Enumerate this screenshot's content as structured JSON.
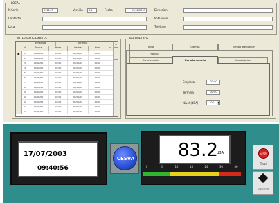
{
  "header": {
    "group_title": "LOCAL",
    "n_serie_label": "N.Serie",
    "n_serie_value": "012147",
    "version_label": "Versión",
    "version_value": "6.1",
    "fecha_label": "Fecha",
    "fecha_value": "07/01/2003",
    "direccion_label": "Dirección",
    "poblacion_label": "Población",
    "telefono_label": "Teléfono",
    "contacto_label": "Contacto",
    "local_label": "Local"
  },
  "intervals": {
    "group_title": "INTERVALOS HABILES",
    "col_group_1": "Empieza",
    "col_group_2": "Termina",
    "col_n": "N.",
    "col_fecha": "Fecha",
    "col_hora": "Hora",
    "rows": [
      {
        "n": "1",
        "f1": "00/00/00",
        "h1": "00:00",
        "f2": "00/00/00",
        "h2": "00:00"
      },
      {
        "n": "2",
        "f1": "00/00/00",
        "h1": "00:00",
        "f2": "00/00/00",
        "h2": "00:00"
      },
      {
        "n": "3",
        "f1": "00/00/00",
        "h1": "00:00",
        "f2": "00/00/00",
        "h2": "00:00"
      },
      {
        "n": "4",
        "f1": "00/00/00",
        "h1": "00:00",
        "f2": "00/00/00",
        "h2": "00:00"
      },
      {
        "n": "5",
        "f1": "00/00/00",
        "h1": "00:00",
        "f2": "00/00/00",
        "h2": "00:00"
      },
      {
        "n": "6",
        "f1": "00/00/00",
        "h1": "00:00",
        "f2": "00/00/00",
        "h2": "00:00"
      },
      {
        "n": "7",
        "f1": "00/00/00",
        "h1": "00:00",
        "f2": "00/00/00",
        "h2": "00:00"
      },
      {
        "n": "8",
        "f1": "00/00/00",
        "h1": "00:00",
        "f2": "00/00/00",
        "h2": "00:00"
      },
      {
        "n": "9",
        "f1": "00/00/00",
        "h1": "00:00",
        "f2": "00/00/00",
        "h2": "00:00"
      },
      {
        "n": "10",
        "f1": "00/00/00",
        "h1": "00:00",
        "f2": "00/00/00",
        "h2": "00:00"
      },
      {
        "n": "11",
        "f1": "00/00/00",
        "h1": "00:00",
        "f2": "00/00/00",
        "h2": "00:00"
      },
      {
        "n": "12",
        "f1": "00/00/00",
        "h1": "00:00",
        "f2": "00/00/00",
        "h2": "00:00"
      },
      {
        "n": "13",
        "f1": "00/00/00",
        "h1": "00:00",
        "f2": "00/00/00",
        "h2": "00:00"
      }
    ]
  },
  "params": {
    "group_title": "PARAMETROS",
    "tab_ruta": "Ruta",
    "tab_ultimos": "Últimos",
    "tab_tiempo": "Tiempo atenuación",
    "tab_rango": "Rango",
    "tab_horario_noche": "Horario noche",
    "tab_horario_marcha": "Horario marcha",
    "tab_visualizacion": "Visualización",
    "empieza_label": "Empieza",
    "empieza_value": "07:00",
    "termina_label": "Termina",
    "termina_value": "00:00",
    "nivel_label": "Nivel (dBA)",
    "nivel_value": "100"
  },
  "device": {
    "date": "17/07/2003",
    "time": "09:40:56",
    "logo_text": "CESVA",
    "level_value": "83.2",
    "level_unit": "dBA",
    "scale_ticks": [
      "0",
      "6",
      "12",
      "18",
      "24",
      "30",
      "36"
    ],
    "stop_label": "Final",
    "next_label": "Siguiente"
  },
  "colors": {
    "bottom_bg": "#2f8e8b",
    "logo_blue": "#2a4fd6",
    "stop_red": "#d42020",
    "bar_green": "#2fb52f",
    "bar_yellow": "#e6d21a",
    "bar_red": "#d42a1a"
  }
}
